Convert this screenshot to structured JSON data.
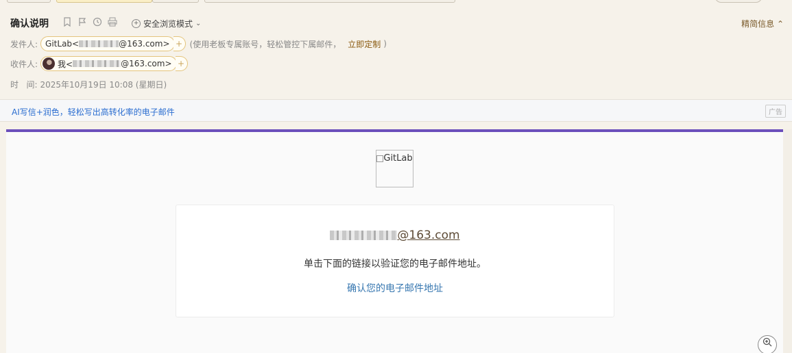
{
  "header": {
    "subject": "确认说明",
    "safe_mode_label": "安全浏览模式",
    "brief_info_label": "精简信息",
    "from_label": "发件人:",
    "from_name_prefix": "GitLab<",
    "from_suffix": "@163.com>",
    "from_note_before": "(使用老板专属账号，轻松管控下属邮件，",
    "from_note_link": "立即定制",
    "from_note_after": ")",
    "to_label": "收件人:",
    "to_name": "我<",
    "to_suffix": "@163.com>",
    "time_label": "时   间:",
    "time_value": "2025年10月19日 10:08 (星期日)",
    "icons": [
      "bookmark-icon",
      "flag-icon",
      "clock-icon",
      "print-icon"
    ]
  },
  "ad": {
    "text": "AI写信+润色，轻松写出高转化率的电子邮件",
    "tag": "广告"
  },
  "body": {
    "logo_alt": "GitLab",
    "email_suffix": "@163.com",
    "message": "单击下面的链接以验证您的电子邮件地址。",
    "confirm_link": "确认您的电子邮件地址"
  },
  "colors": {
    "accent_bar": "#6b4fbb",
    "link": "#3777b0",
    "ad_link": "#2a6dd0"
  }
}
